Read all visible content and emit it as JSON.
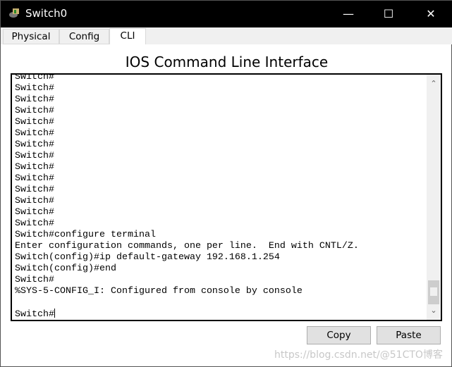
{
  "window": {
    "title": "Switch0",
    "icon": "switch-device-icon",
    "minimize_icon": "minimize-icon",
    "maximize_icon": "maximize-icon",
    "close_icon": "close-icon"
  },
  "tabs": [
    {
      "label": "Physical"
    },
    {
      "label": "Config"
    },
    {
      "label": "CLI",
      "active": true
    }
  ],
  "heading": "IOS Command Line Interface",
  "terminal": {
    "lines": [
      "Switch#",
      "Switch#",
      "Switch#",
      "Switch#",
      "Switch#",
      "Switch#",
      "Switch#",
      "Switch#",
      "Switch#",
      "Switch#",
      "Switch#",
      "Switch#",
      "Switch#",
      "Switch#",
      "Switch#configure terminal",
      "Enter configuration commands, one per line.  End with CNTL/Z.",
      "Switch(config)#ip default-gateway 192.168.1.254",
      "Switch(config)#end",
      "Switch#",
      "%SYS-5-CONFIG_I: Configured from console by console",
      ""
    ],
    "prompt": "Switch#"
  },
  "buttons": {
    "copy": "Copy",
    "paste": "Paste"
  },
  "watermark": "https://blog.csdn.net/@51CTO博客"
}
